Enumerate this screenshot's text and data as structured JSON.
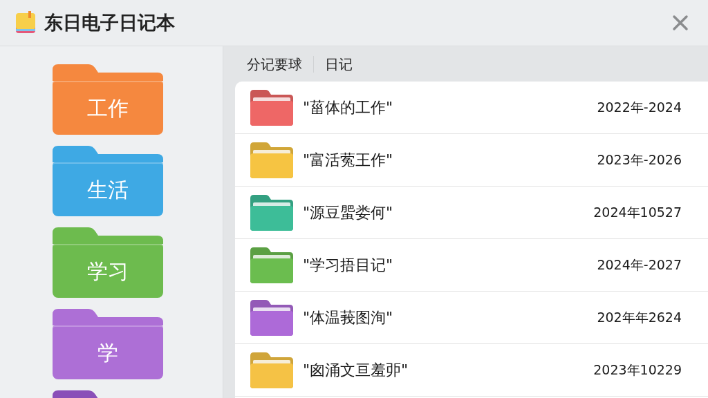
{
  "window": {
    "title": "东日电子日记本"
  },
  "sidebar": {
    "items": [
      {
        "label": "工作",
        "color": "#f5883f"
      },
      {
        "label": "生活",
        "color": "#3ea9e4"
      },
      {
        "label": "学习",
        "color": "#6dbb4e"
      },
      {
        "label": "学",
        "color": "#ad6fd6"
      },
      {
        "color": "#8a4fb8"
      }
    ]
  },
  "tabs": [
    {
      "label": "分记要球"
    },
    {
      "label": "日记"
    }
  ],
  "list": {
    "rows": [
      {
        "name": "\"菑体的工作\"",
        "date": "2022年-2024",
        "color": "#ee6766"
      },
      {
        "name": "\"富活蒬王作\"",
        "date": "2023年-2026",
        "color": "#f6c442"
      },
      {
        "name": "\"源豆蜰娄何\"",
        "date": "2024年10527",
        "color": "#3dbd98"
      },
      {
        "name": "\"学习捂目记\"",
        "date": "2024年-2027",
        "color": "#6bbd4f"
      },
      {
        "name": "\"体温莪图洵\"",
        "date": "202年年2624",
        "color": "#ad6ad8"
      },
      {
        "name": "\"囪涌文亘羞戼\"",
        "date": "2023年10229",
        "color": "#f5c245"
      }
    ]
  }
}
